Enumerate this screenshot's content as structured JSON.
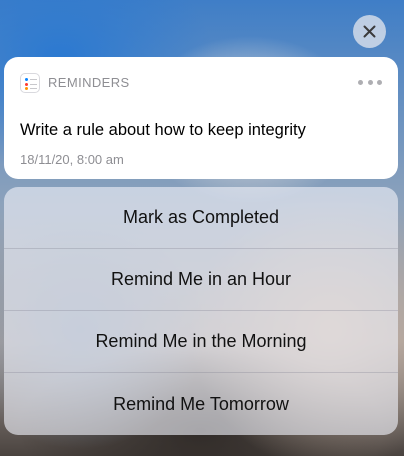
{
  "notification": {
    "app_name": "REMINDERS",
    "app_icon": "reminders-app-icon",
    "more_icon": "ellipsis-icon",
    "title": "Write a rule about how to keep integrity",
    "timestamp": "18/11/20, 8:00 am"
  },
  "close_button": {
    "icon": "close-icon"
  },
  "actions": [
    {
      "label": "Mark as Completed"
    },
    {
      "label": "Remind Me in an Hour"
    },
    {
      "label": "Remind Me in the Morning"
    },
    {
      "label": "Remind Me Tomorrow"
    }
  ]
}
